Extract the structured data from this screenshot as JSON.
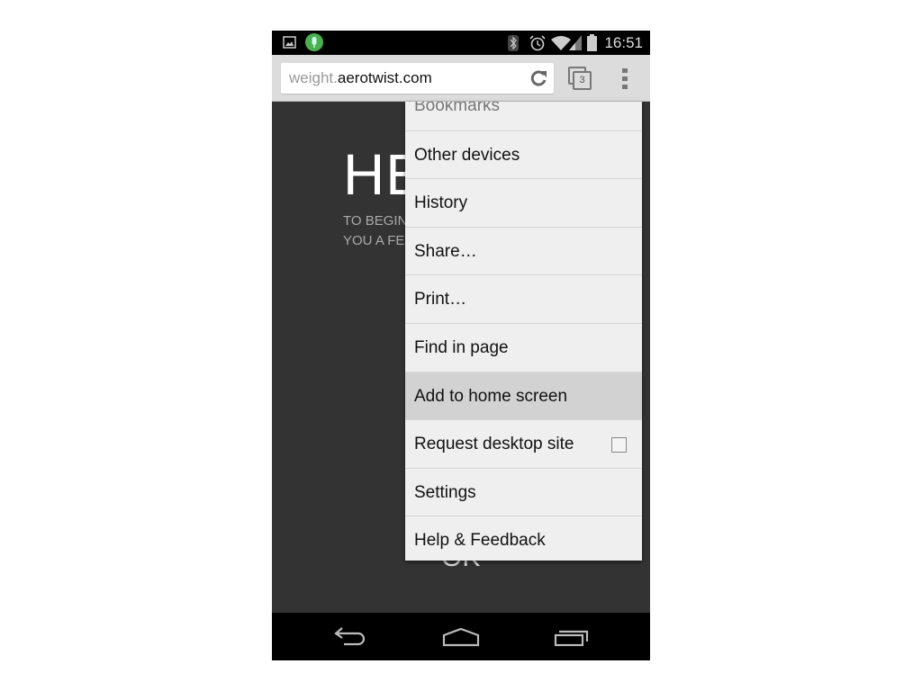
{
  "status_bar": {
    "time": "16:51",
    "icons": [
      "image-icon",
      "microphone-icon",
      "bluetooth-icon",
      "alarm-icon",
      "wifi-icon",
      "signal-icon",
      "battery-icon"
    ]
  },
  "toolbar": {
    "url_sub": "weight.",
    "url_domain": "aerotwist.com",
    "tab_count": "3"
  },
  "page": {
    "hero": "HE",
    "intro_line1": "TO BEGIN",
    "intro_line2": "YOU A FE",
    "ok": "OK"
  },
  "menu": {
    "items": [
      {
        "label": "Bookmarks"
      },
      {
        "label": "Other devices"
      },
      {
        "label": "History"
      },
      {
        "label": "Share…"
      },
      {
        "label": "Print…"
      },
      {
        "label": "Find in page"
      },
      {
        "label": "Add to home screen",
        "highlighted": true
      },
      {
        "label": "Request desktop site",
        "checkbox": false
      },
      {
        "label": "Settings"
      },
      {
        "label": "Help & Feedback"
      }
    ]
  },
  "colors": {
    "background": "#333333",
    "menu": "#efefef",
    "highlight": "#d2d2d2",
    "accent_mic": "#4caf50"
  }
}
